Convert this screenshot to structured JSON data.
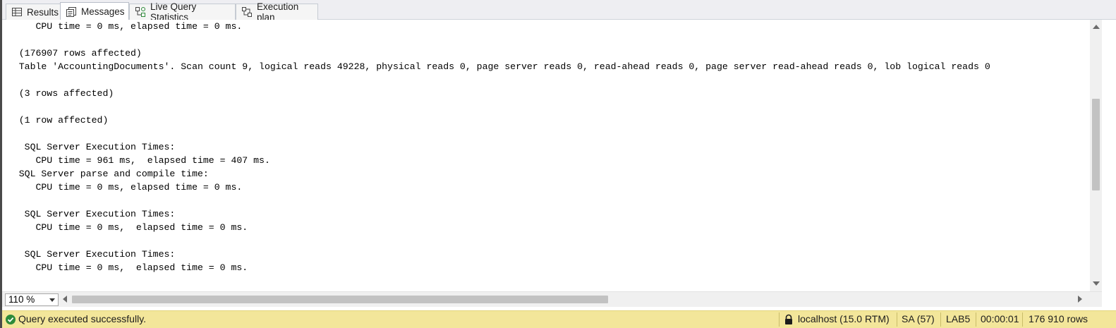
{
  "tabs": [
    {
      "label": "Results",
      "icon": "grid-icon"
    },
    {
      "label": "Messages",
      "icon": "messages-icon"
    },
    {
      "label": "Live Query Statistics",
      "icon": "live-query-stats-icon"
    },
    {
      "label": "Execution plan",
      "icon": "execution-plan-icon"
    }
  ],
  "active_tab": "Messages",
  "messages": [
    "      CPU time = 0 ms, elapsed time = 0 ms.",
    "",
    "   (176907 rows affected)",
    "   Table 'AccountingDocuments'. Scan count 9, logical reads 49228, physical reads 0, page server reads 0, read-ahead reads 0, page server read-ahead reads 0, lob logical reads 0",
    "",
    "   (3 rows affected)",
    "",
    "   (1 row affected)",
    "",
    "    SQL Server Execution Times:",
    "      CPU time = 961 ms,  elapsed time = 407 ms.",
    "   SQL Server parse and compile time:",
    "      CPU time = 0 ms, elapsed time = 0 ms.",
    "",
    "    SQL Server Execution Times:",
    "      CPU time = 0 ms,  elapsed time = 0 ms.",
    "",
    "    SQL Server Execution Times:",
    "      CPU time = 0 ms,  elapsed time = 0 ms."
  ],
  "zoom": {
    "value": "110 %"
  },
  "status": {
    "message": "Query executed successfully.",
    "server": "localhost (15.0 RTM)",
    "user": "SA (57)",
    "database": "LAB5",
    "elapsed": "00:00:01",
    "rows": "176 910 rows",
    "bar_color": "#f3e69a",
    "success_color": "#2e8b3a"
  }
}
